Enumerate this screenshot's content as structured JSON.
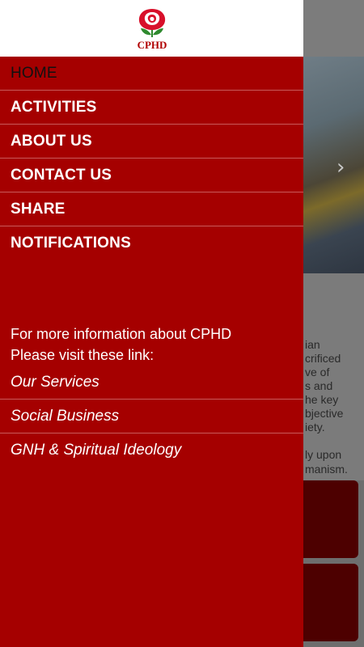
{
  "background": {
    "text_lines": [
      "ian",
      "crificed",
      "ve of",
      "s and",
      "he key",
      "bjective",
      "iety.",
      "",
      "ly upon",
      "manism."
    ]
  },
  "drawer": {
    "logo_text": "CPHD",
    "menu": [
      {
        "label": "HOME"
      },
      {
        "label": "ACTIVITIES"
      },
      {
        "label": "ABOUT US"
      },
      {
        "label": "CONTACT US"
      },
      {
        "label": "SHARE"
      },
      {
        "label": "NOTIFICATIONS"
      }
    ],
    "info_line1": "For more information about CPHD",
    "info_line2": "Please visit these link:",
    "links": [
      {
        "label": "Our Services"
      },
      {
        "label": "Social Business"
      },
      {
        "label": "GNH & Spiritual Ideology"
      }
    ]
  },
  "colors": {
    "drawer_bg": "#a50000",
    "accent": "#b00000"
  }
}
